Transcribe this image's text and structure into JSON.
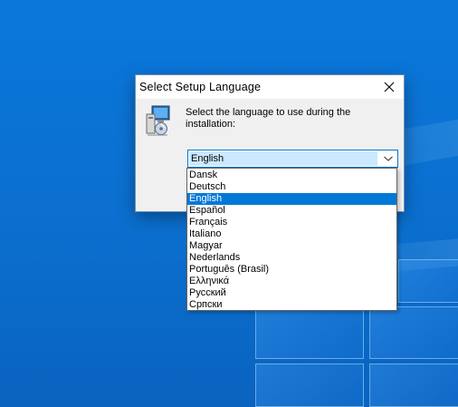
{
  "dialog": {
    "title": "Select Setup Language",
    "prompt": "Select the language to use during the installation:",
    "selected_value": "English"
  },
  "icons": {
    "close": "close-icon",
    "setup": "setup-computer-icon",
    "dropdown_arrow": "chevron-down-icon"
  },
  "languages": [
    "Dansk",
    "Deutsch",
    "English",
    "Español",
    "Français",
    "Italiano",
    "Magyar",
    "Nederlands",
    "Português (Brasil)",
    "Ελληνικά",
    "Русский",
    "Српски"
  ],
  "selected_index": 2,
  "colors": {
    "accent": "#0078d7",
    "desktop": "#0b74d6"
  }
}
